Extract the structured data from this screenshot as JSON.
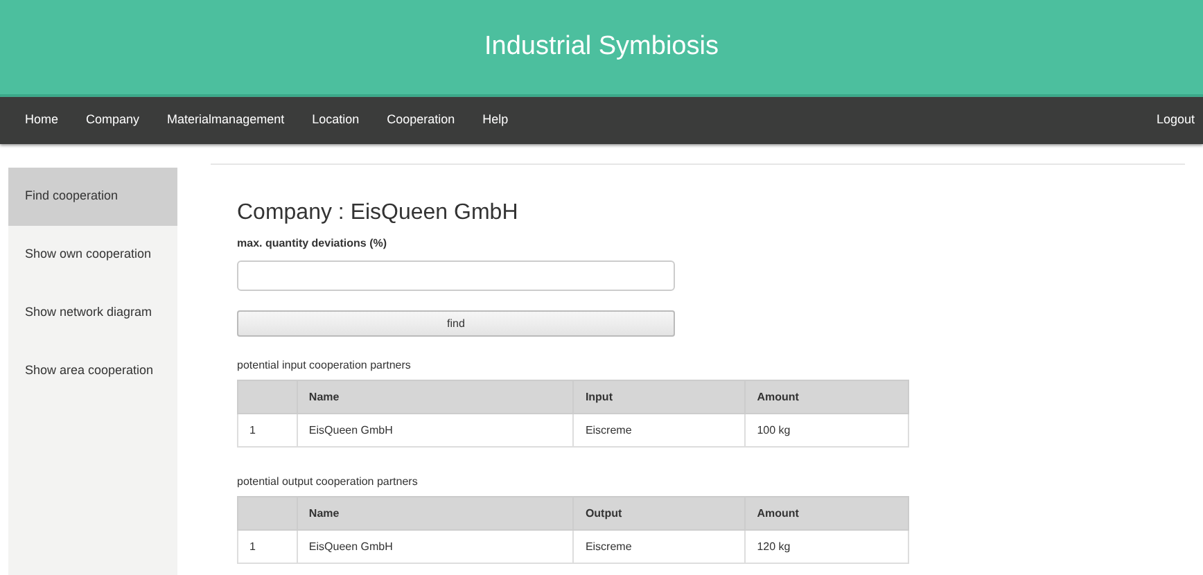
{
  "header": {
    "title": "Industrial Symbiosis"
  },
  "nav": {
    "items": [
      {
        "label": "Home"
      },
      {
        "label": "Company"
      },
      {
        "label": "Materialmanagement"
      },
      {
        "label": "Location"
      },
      {
        "label": "Cooperation"
      },
      {
        "label": "Help"
      }
    ],
    "logout": "Logout"
  },
  "sidebar": {
    "items": [
      {
        "label": "Find cooperation",
        "selected": true
      },
      {
        "label": "Show own cooperation",
        "selected": false
      },
      {
        "label": "Show network diagram",
        "selected": false
      },
      {
        "label": "Show area cooperation",
        "selected": false
      }
    ]
  },
  "main": {
    "title": "Company : EisQueen GmbH",
    "field_label": "max. quantity deviations (%)",
    "find_button": "find",
    "tables": [
      {
        "caption": "potential input cooperation partners",
        "columns": [
          "",
          "Name",
          "Input",
          "Amount"
        ],
        "rows": [
          [
            "1",
            "EisQueen GmbH",
            "Eiscreme",
            "100 kg"
          ]
        ]
      },
      {
        "caption": "potential output cooperation partners",
        "columns": [
          "",
          "Name",
          "Output",
          "Amount"
        ],
        "rows": [
          [
            "1",
            "EisQueen GmbH",
            "Eiscreme",
            "120 kg"
          ]
        ]
      }
    ]
  }
}
